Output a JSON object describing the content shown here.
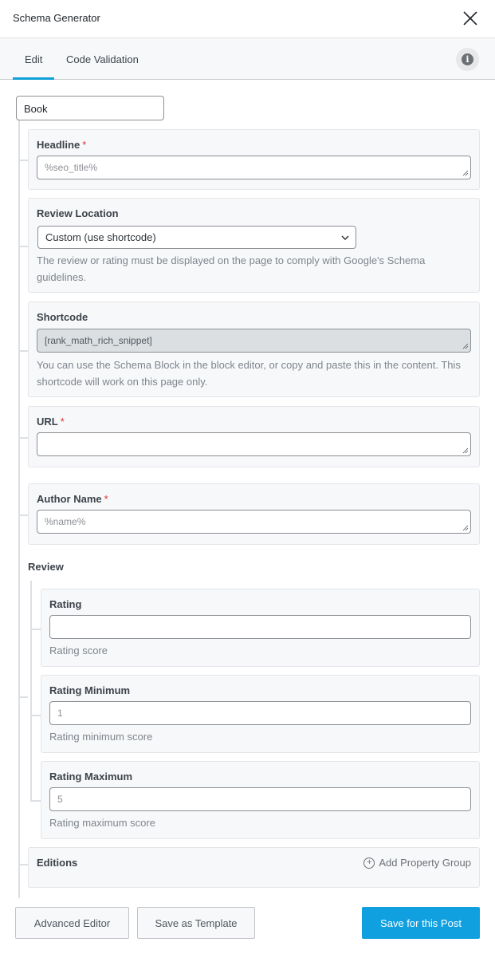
{
  "header": {
    "title": "Schema Generator",
    "close_icon": "close-icon"
  },
  "tabs": [
    {
      "label": "Edit",
      "active": true
    },
    {
      "label": "Code Validation",
      "active": false
    }
  ],
  "info_icon": "i",
  "schema_type": "Book",
  "fields": {
    "headline": {
      "label": "Headline",
      "required": "*",
      "placeholder": "%seo_title%",
      "value": ""
    },
    "review_location": {
      "label": "Review Location",
      "selected": "Custom (use shortcode)",
      "description": "The review or rating must be displayed on the page to comply with Google's Schema guidelines."
    },
    "shortcode": {
      "label": "Shortcode",
      "value": "[rank_math_rich_snippet]",
      "description": "You can use the Schema Block in the block editor, or copy and paste this in the content. This shortcode will work on this page only."
    },
    "url": {
      "label": "URL",
      "required": "*",
      "value": ""
    },
    "author_name": {
      "label": "Author Name",
      "required": "*",
      "placeholder": "%name%",
      "value": ""
    }
  },
  "review": {
    "label": "Review",
    "rating": {
      "label": "Rating",
      "value": "",
      "description": "Rating score"
    },
    "rating_min": {
      "label": "Rating Minimum",
      "placeholder": "1",
      "description": "Rating minimum score"
    },
    "rating_max": {
      "label": "Rating Maximum",
      "value": "5",
      "description": "Rating maximum score"
    }
  },
  "editions": {
    "label": "Editions",
    "add_label": "Add Property Group",
    "add_icon": "+"
  },
  "footer": {
    "advanced_editor": "Advanced Editor",
    "save_template": "Save as Template",
    "save_post": "Save for this Post"
  },
  "colors": {
    "accent": "#10a0e0",
    "required": "#dc3232"
  }
}
